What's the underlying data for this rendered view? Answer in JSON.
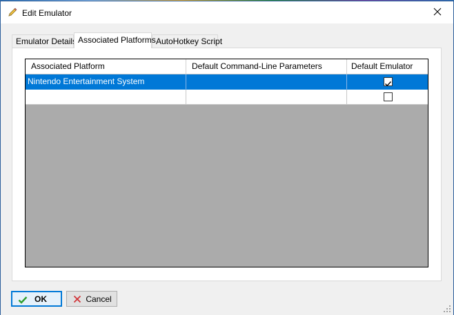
{
  "window": {
    "title": "Edit Emulator",
    "close_glyph": "✕"
  },
  "tabs": [
    {
      "label": "Emulator Details",
      "active": false
    },
    {
      "label": "Associated Platforms",
      "active": true
    },
    {
      "label": "AutoHotkey Script",
      "active": false
    }
  ],
  "grid": {
    "columns": [
      "Associated Platform",
      "Default Command-Line Parameters",
      "Default Emulator"
    ],
    "rows": [
      {
        "platform": "Nintendo Entertainment System",
        "params": "",
        "default_emulator": true,
        "selected": true
      },
      {
        "platform": "",
        "params": "",
        "default_emulator": false,
        "selected": false
      }
    ]
  },
  "buttons": {
    "ok": "OK",
    "cancel": "Cancel"
  },
  "colors": {
    "selection": "#0078d7",
    "grid_empty": "#ababab",
    "ok_check": "#2e9e2e",
    "cancel_x": "#d13438"
  },
  "icons": {
    "title": "pencil-icon",
    "close": "close-icon",
    "ok": "checkmark-icon",
    "cancel": "x-icon",
    "grip": "resize-grip-icon"
  }
}
